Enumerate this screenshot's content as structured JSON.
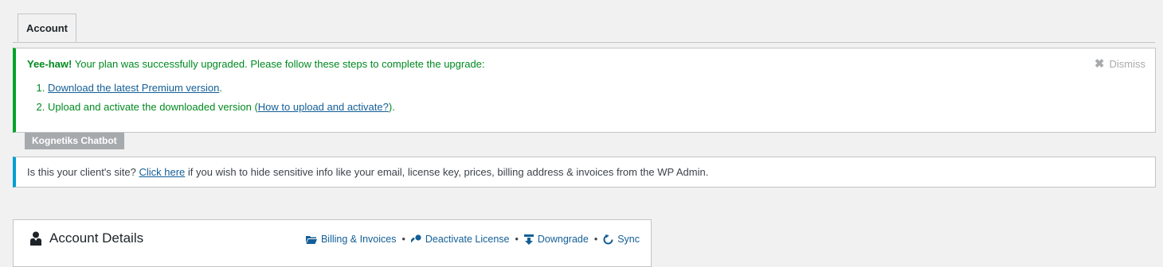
{
  "tabs": [
    {
      "label": "Account"
    }
  ],
  "notice": {
    "bold": "Yee-haw!",
    "message": " Your plan was successfully upgraded. Please follow these steps to complete the upgrade:",
    "dismiss_label": "Dismiss",
    "steps": [
      {
        "prefix": "",
        "link": "Download the latest Premium version",
        "suffix": "."
      },
      {
        "prefix": "Upload and activate the downloaded version (",
        "link": "How to upload and activate?",
        "suffix": ")."
      }
    ]
  },
  "plugin_badge": "Kognetiks Chatbot",
  "client_notice": {
    "prefix": "Is this your client's site? ",
    "link": "Click here",
    "suffix": " if you wish to hide sensitive info like your email, license key, prices, billing address & invoices from the WP Admin."
  },
  "account": {
    "title": "Account Details",
    "actions": [
      {
        "label": "Billing & Invoices",
        "icon": "folder-icon"
      },
      {
        "label": "Deactivate License",
        "icon": "key-icon"
      },
      {
        "label": "Downgrade",
        "icon": "download-icon"
      },
      {
        "label": "Sync",
        "icon": "refresh-icon"
      }
    ],
    "separator": "•"
  },
  "colors": {
    "success": "#00a32a",
    "info": "#00a0d2",
    "link": "#135e96"
  }
}
